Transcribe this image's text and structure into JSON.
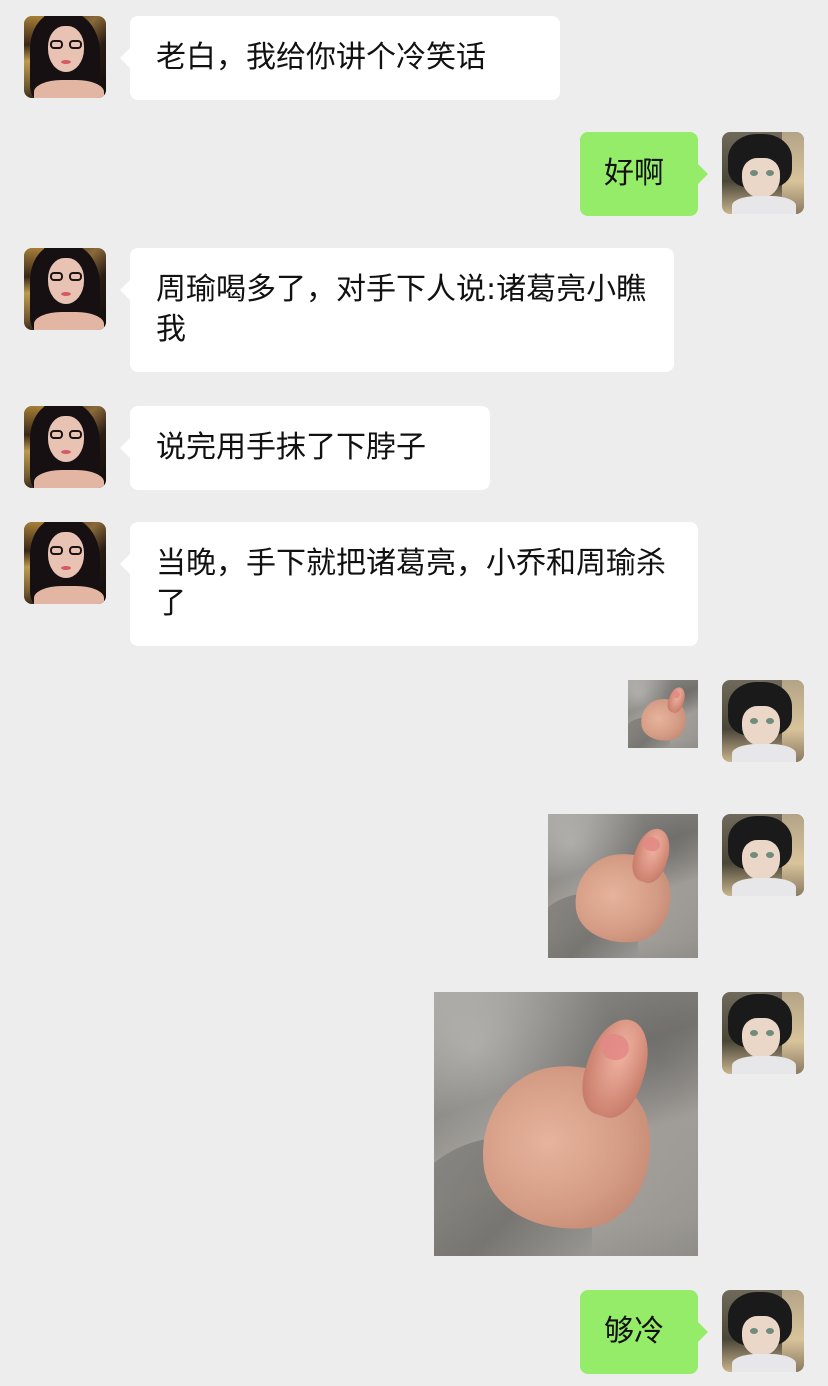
{
  "conversation": {
    "messages": [
      {
        "side": "left",
        "type": "text",
        "text": "老白，我给你讲个冷笑话"
      },
      {
        "side": "right",
        "type": "text",
        "text": "好啊"
      },
      {
        "side": "left",
        "type": "text",
        "text": "周瑜喝多了，对手下人说:诸葛亮小瞧我"
      },
      {
        "side": "left",
        "type": "text",
        "text": "说完用手抹了下脖子"
      },
      {
        "side": "left",
        "type": "text",
        "text": "当晚，手下就把诸葛亮，小乔和周瑜杀了"
      },
      {
        "side": "right",
        "type": "image",
        "image": "thumbs-up-photo"
      },
      {
        "side": "right",
        "type": "image",
        "image": "thumbs-up-photo"
      },
      {
        "side": "right",
        "type": "image",
        "image": "thumbs-up-photo"
      },
      {
        "side": "right",
        "type": "text",
        "text": "够冷"
      }
    ]
  },
  "theme": {
    "background": "#ededed",
    "bubble_left": "#ffffff",
    "bubble_right": "#95ec69",
    "text": "#111111"
  }
}
